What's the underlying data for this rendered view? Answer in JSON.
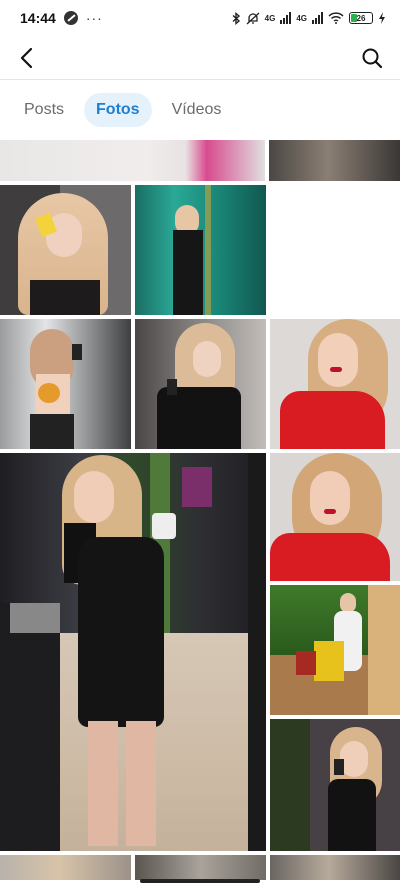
{
  "status": {
    "time": "14:44",
    "more": "···",
    "network_a": "4G",
    "network_b": "4G",
    "battery": "26"
  },
  "header": {
    "back_icon": "back-arrow-icon",
    "search_icon": "search-icon"
  },
  "tabs": [
    {
      "label": "Posts",
      "active": false
    },
    {
      "label": "Fotos",
      "active": true
    },
    {
      "label": "Vídeos",
      "active": false
    }
  ],
  "colors": {
    "accent": "#1d7fd0",
    "tab_active_bg": "#e6f2fb",
    "tab_inactive": "#6b6b6b"
  }
}
